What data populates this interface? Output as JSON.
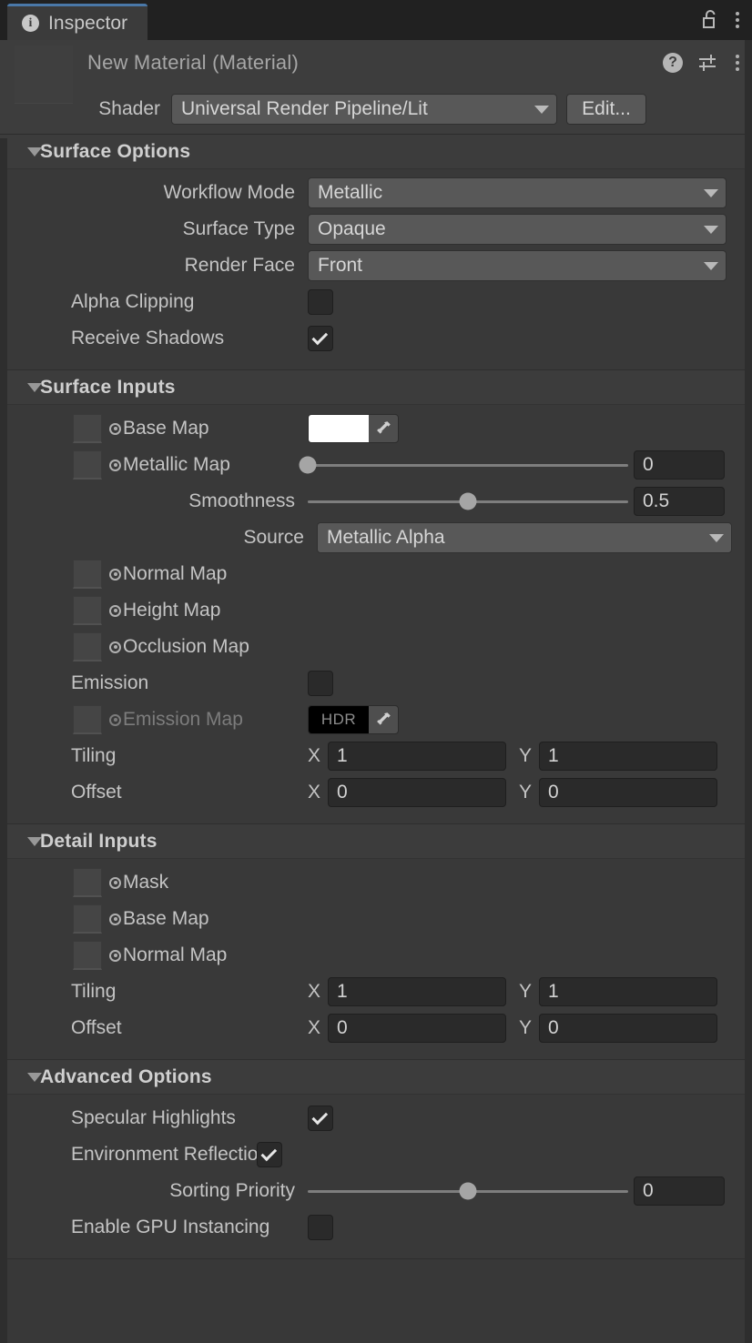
{
  "window": {
    "tab_label": "Inspector",
    "tab_icon": "info-icon",
    "lock_icon": "unlocked-padlock-icon",
    "menu_icon": "kebab-menu-icon",
    "accent_color": "#4a78a8"
  },
  "material_header": {
    "title": "New Material (Material)",
    "help_icon": "help-question-icon",
    "preset_icon": "preset-sliders-icon",
    "menu_icon": "kebab-menu-icon",
    "shader_label": "Shader",
    "shader_value": "Universal Render Pipeline/Lit",
    "edit_label": "Edit..."
  },
  "sections": [
    {
      "title": "Surface Options",
      "expanded": true,
      "rows": [
        {
          "kind": "dropdown",
          "label": "Workflow Mode",
          "value": "Metallic"
        },
        {
          "kind": "dropdown",
          "label": "Surface Type",
          "value": "Opaque"
        },
        {
          "kind": "dropdown",
          "label": "Render Face",
          "value": "Front"
        },
        {
          "kind": "checkbox",
          "label": "Alpha Clipping",
          "checked": false
        },
        {
          "kind": "checkbox",
          "label": "Receive Shadows",
          "checked": true
        }
      ]
    },
    {
      "title": "Surface Inputs",
      "expanded": true,
      "rows": [
        {
          "kind": "texture-color",
          "label": "Base Map",
          "color": "#ffffff",
          "hdr": false
        },
        {
          "kind": "texture-slider",
          "label": "Metallic Map",
          "value": "0",
          "fraction": 0.0
        },
        {
          "kind": "slider",
          "label": "Smoothness",
          "value": "0.5",
          "fraction": 0.5
        },
        {
          "kind": "dropdown-indent",
          "label": "Source",
          "value": "Metallic Alpha"
        },
        {
          "kind": "texture",
          "label": "Normal Map"
        },
        {
          "kind": "texture",
          "label": "Height Map"
        },
        {
          "kind": "texture",
          "label": "Occlusion Map"
        },
        {
          "kind": "checkbox",
          "label": "Emission",
          "checked": false
        },
        {
          "kind": "texture-color",
          "label": "Emission Map",
          "color": "#000000",
          "hdr": true,
          "hdr_label": "HDR",
          "disabled": true
        },
        {
          "kind": "vector2",
          "label": "Tiling",
          "x_axis": "X",
          "x": "1",
          "y_axis": "Y",
          "y": "1"
        },
        {
          "kind": "vector2",
          "label": "Offset",
          "x_axis": "X",
          "x": "0",
          "y_axis": "Y",
          "y": "0"
        }
      ]
    },
    {
      "title": "Detail Inputs",
      "expanded": true,
      "rows": [
        {
          "kind": "texture",
          "label": "Mask"
        },
        {
          "kind": "texture",
          "label": "Base Map"
        },
        {
          "kind": "texture",
          "label": "Normal Map"
        },
        {
          "kind": "vector2",
          "label": "Tiling",
          "x_axis": "X",
          "x": "1",
          "y_axis": "Y",
          "y": "1"
        },
        {
          "kind": "vector2",
          "label": "Offset",
          "x_axis": "X",
          "x": "0",
          "y_axis": "Y",
          "y": "0"
        }
      ]
    },
    {
      "title": "Advanced Options",
      "expanded": true,
      "rows": [
        {
          "kind": "checkbox",
          "label": "Specular Highlights",
          "checked": true
        },
        {
          "kind": "checkbox",
          "label": "Environment Reflections",
          "checked": true
        },
        {
          "kind": "slider",
          "label": "Sorting Priority",
          "value": "0",
          "fraction": 0.5
        },
        {
          "kind": "checkbox",
          "label": "Enable GPU Instancing",
          "checked": false
        }
      ]
    }
  ]
}
